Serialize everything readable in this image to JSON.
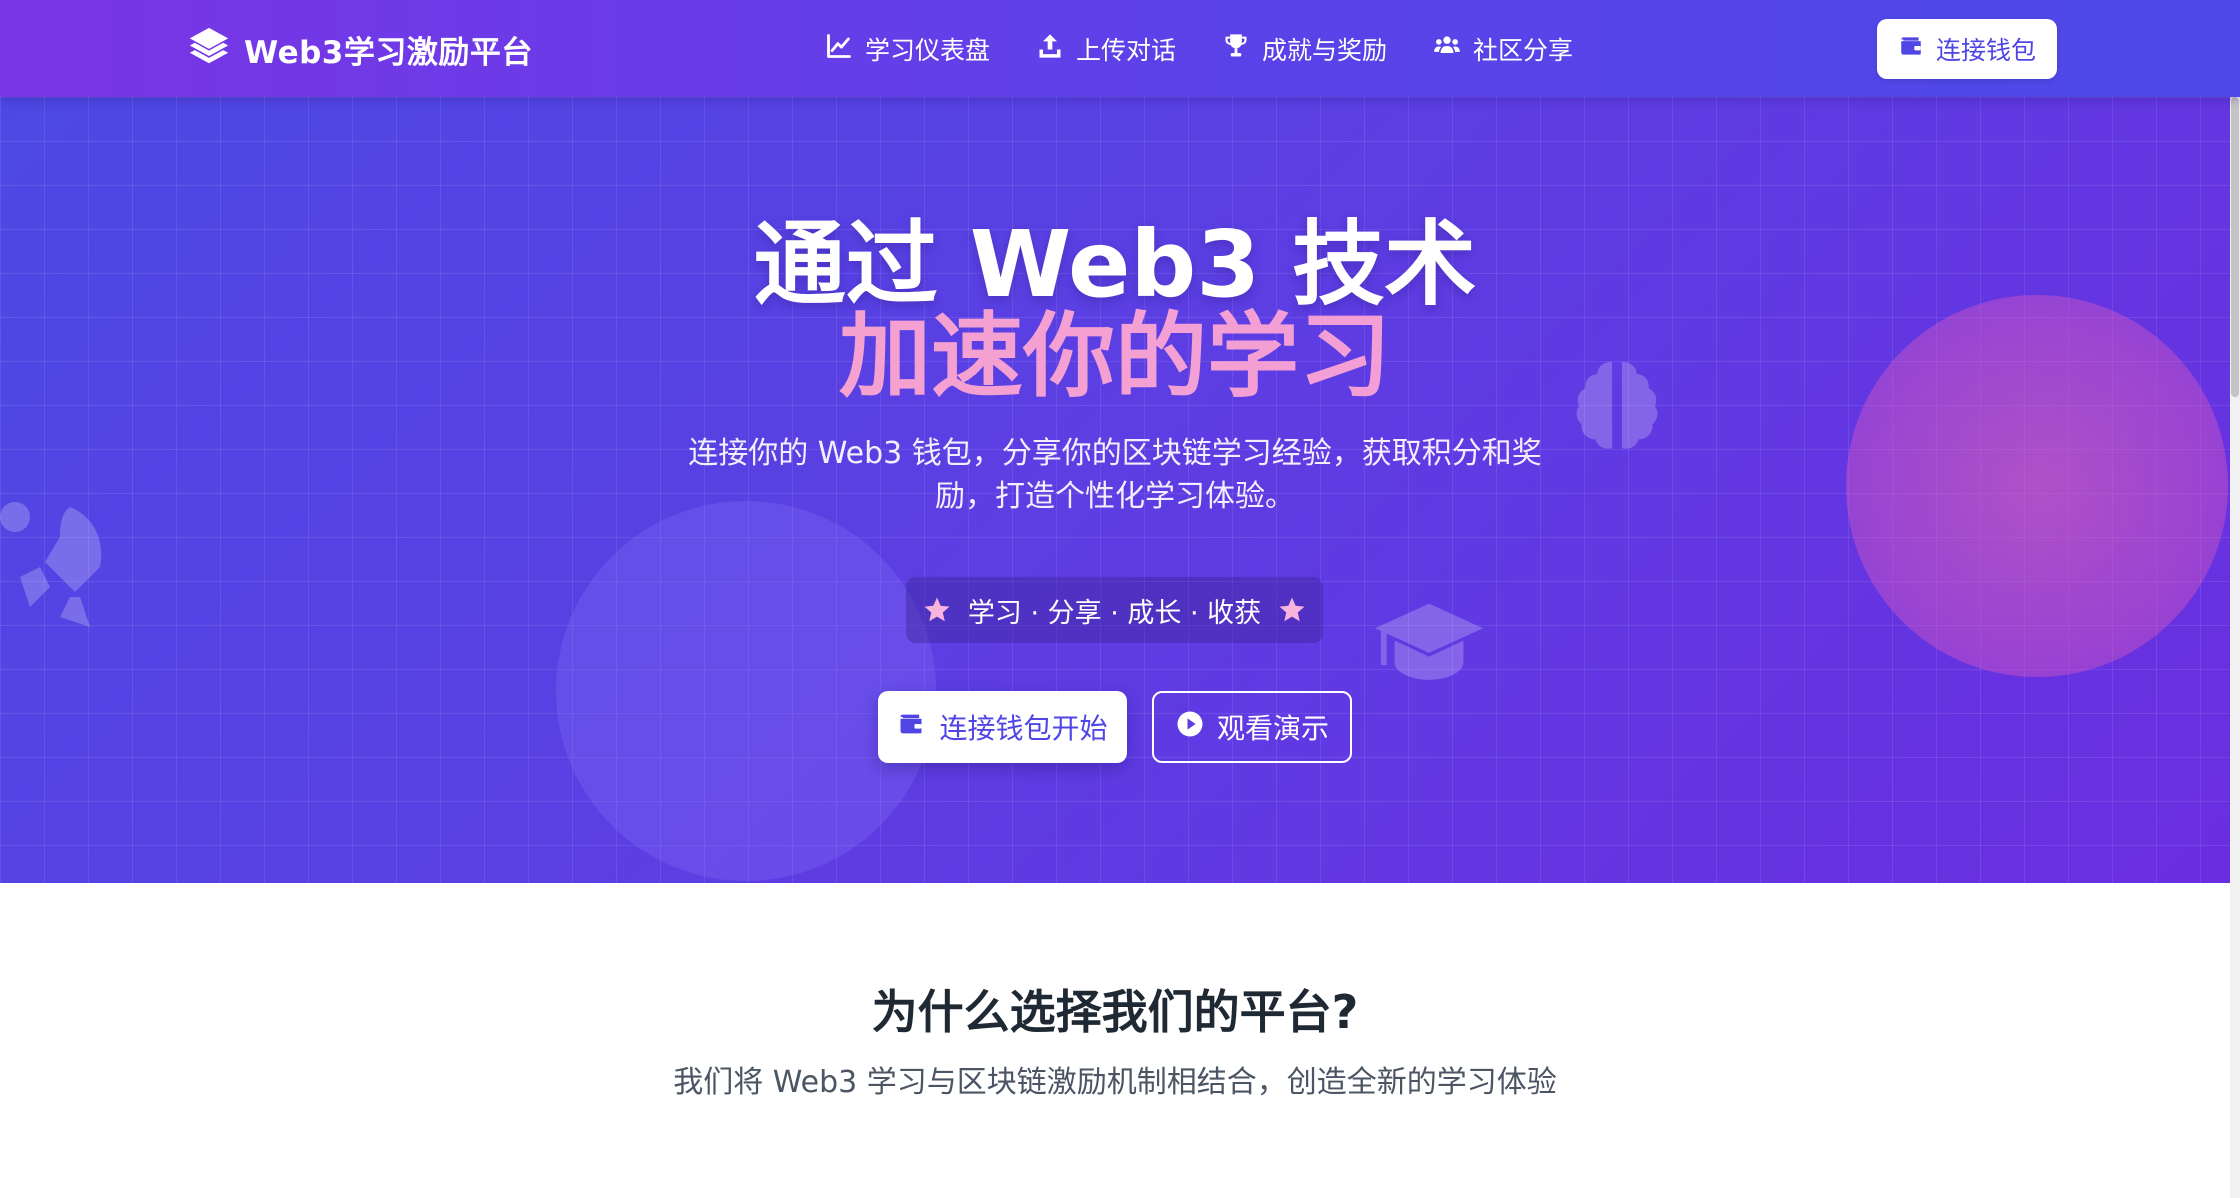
{
  "nav": {
    "brand": "Web3学习激励平台",
    "links": [
      {
        "label": "学习仪表盘",
        "icon": "chart-line-icon"
      },
      {
        "label": "上传对话",
        "icon": "upload-icon"
      },
      {
        "label": "成就与奖励",
        "icon": "trophy-icon"
      },
      {
        "label": "社区分享",
        "icon": "users-icon"
      }
    ],
    "cta": "连接钱包"
  },
  "hero": {
    "title_line1": "通过 Web3 技术",
    "title_line2": "加速你的学习",
    "description": "连接你的 Web3 钱包，分享你的区块链学习经验，获取积分和奖励，打造个性化学习体验。",
    "tagline": "学习 · 分享 · 成长 · 收获",
    "primary_button": "连接钱包开始",
    "secondary_button": "观看演示"
  },
  "why": {
    "title": "为什么选择我们的平台?",
    "subtitle": "我们将 Web3 学习与区块链激励机制相结合，创造全新的学习体验"
  },
  "colors": {
    "accent": "#4f46e5",
    "highlight_pink": "#f5a9d6",
    "hero_start": "#4d48e4",
    "hero_end": "#6a2ee0"
  }
}
